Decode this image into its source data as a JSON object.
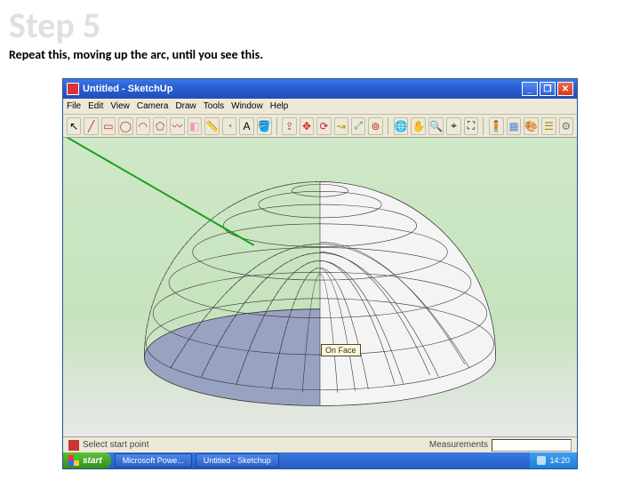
{
  "step": {
    "title": "Step 5",
    "caption": "Repeat this, moving up the arc, until you see this."
  },
  "window": {
    "doc": "Untitled",
    "app": "SketchUp"
  },
  "winButtons": {
    "min": "_",
    "max": "❐",
    "close": "✕"
  },
  "menu": {
    "file": "File",
    "edit": "Edit",
    "view": "View",
    "camera": "Camera",
    "draw": "Draw",
    "tools": "Tools",
    "window": "Window",
    "help": "Help"
  },
  "tooltip": "On Face",
  "status": {
    "hint": "Select start point",
    "measureLabel": "Measurements"
  },
  "taskbar": {
    "start": "start",
    "task1": "Microsoft Powe...",
    "task2": "Untitled - Sketchup",
    "clock": "14:20"
  },
  "icons": {
    "select": "↖",
    "line": "╱",
    "square": "▭",
    "circle": "◯",
    "arc": "◠",
    "poly": "⬠",
    "free": "〰",
    "eraser": "◧",
    "tape": "📏",
    "protractor": "◔",
    "text": "A",
    "paint": "🪣",
    "push": "⇪",
    "move": "✥",
    "rotate": "⟳",
    "follow": "↝",
    "scale": "⤢",
    "offset": "⊚",
    "orbit": "🌐",
    "pan": "✋",
    "zoom": "🔍",
    "zoomwin": "⌖",
    "zoomext": "⛶",
    "person": "🧍",
    "component": "▦",
    "mat": "🎨",
    "layer": "☰",
    "gear": "⚙"
  }
}
